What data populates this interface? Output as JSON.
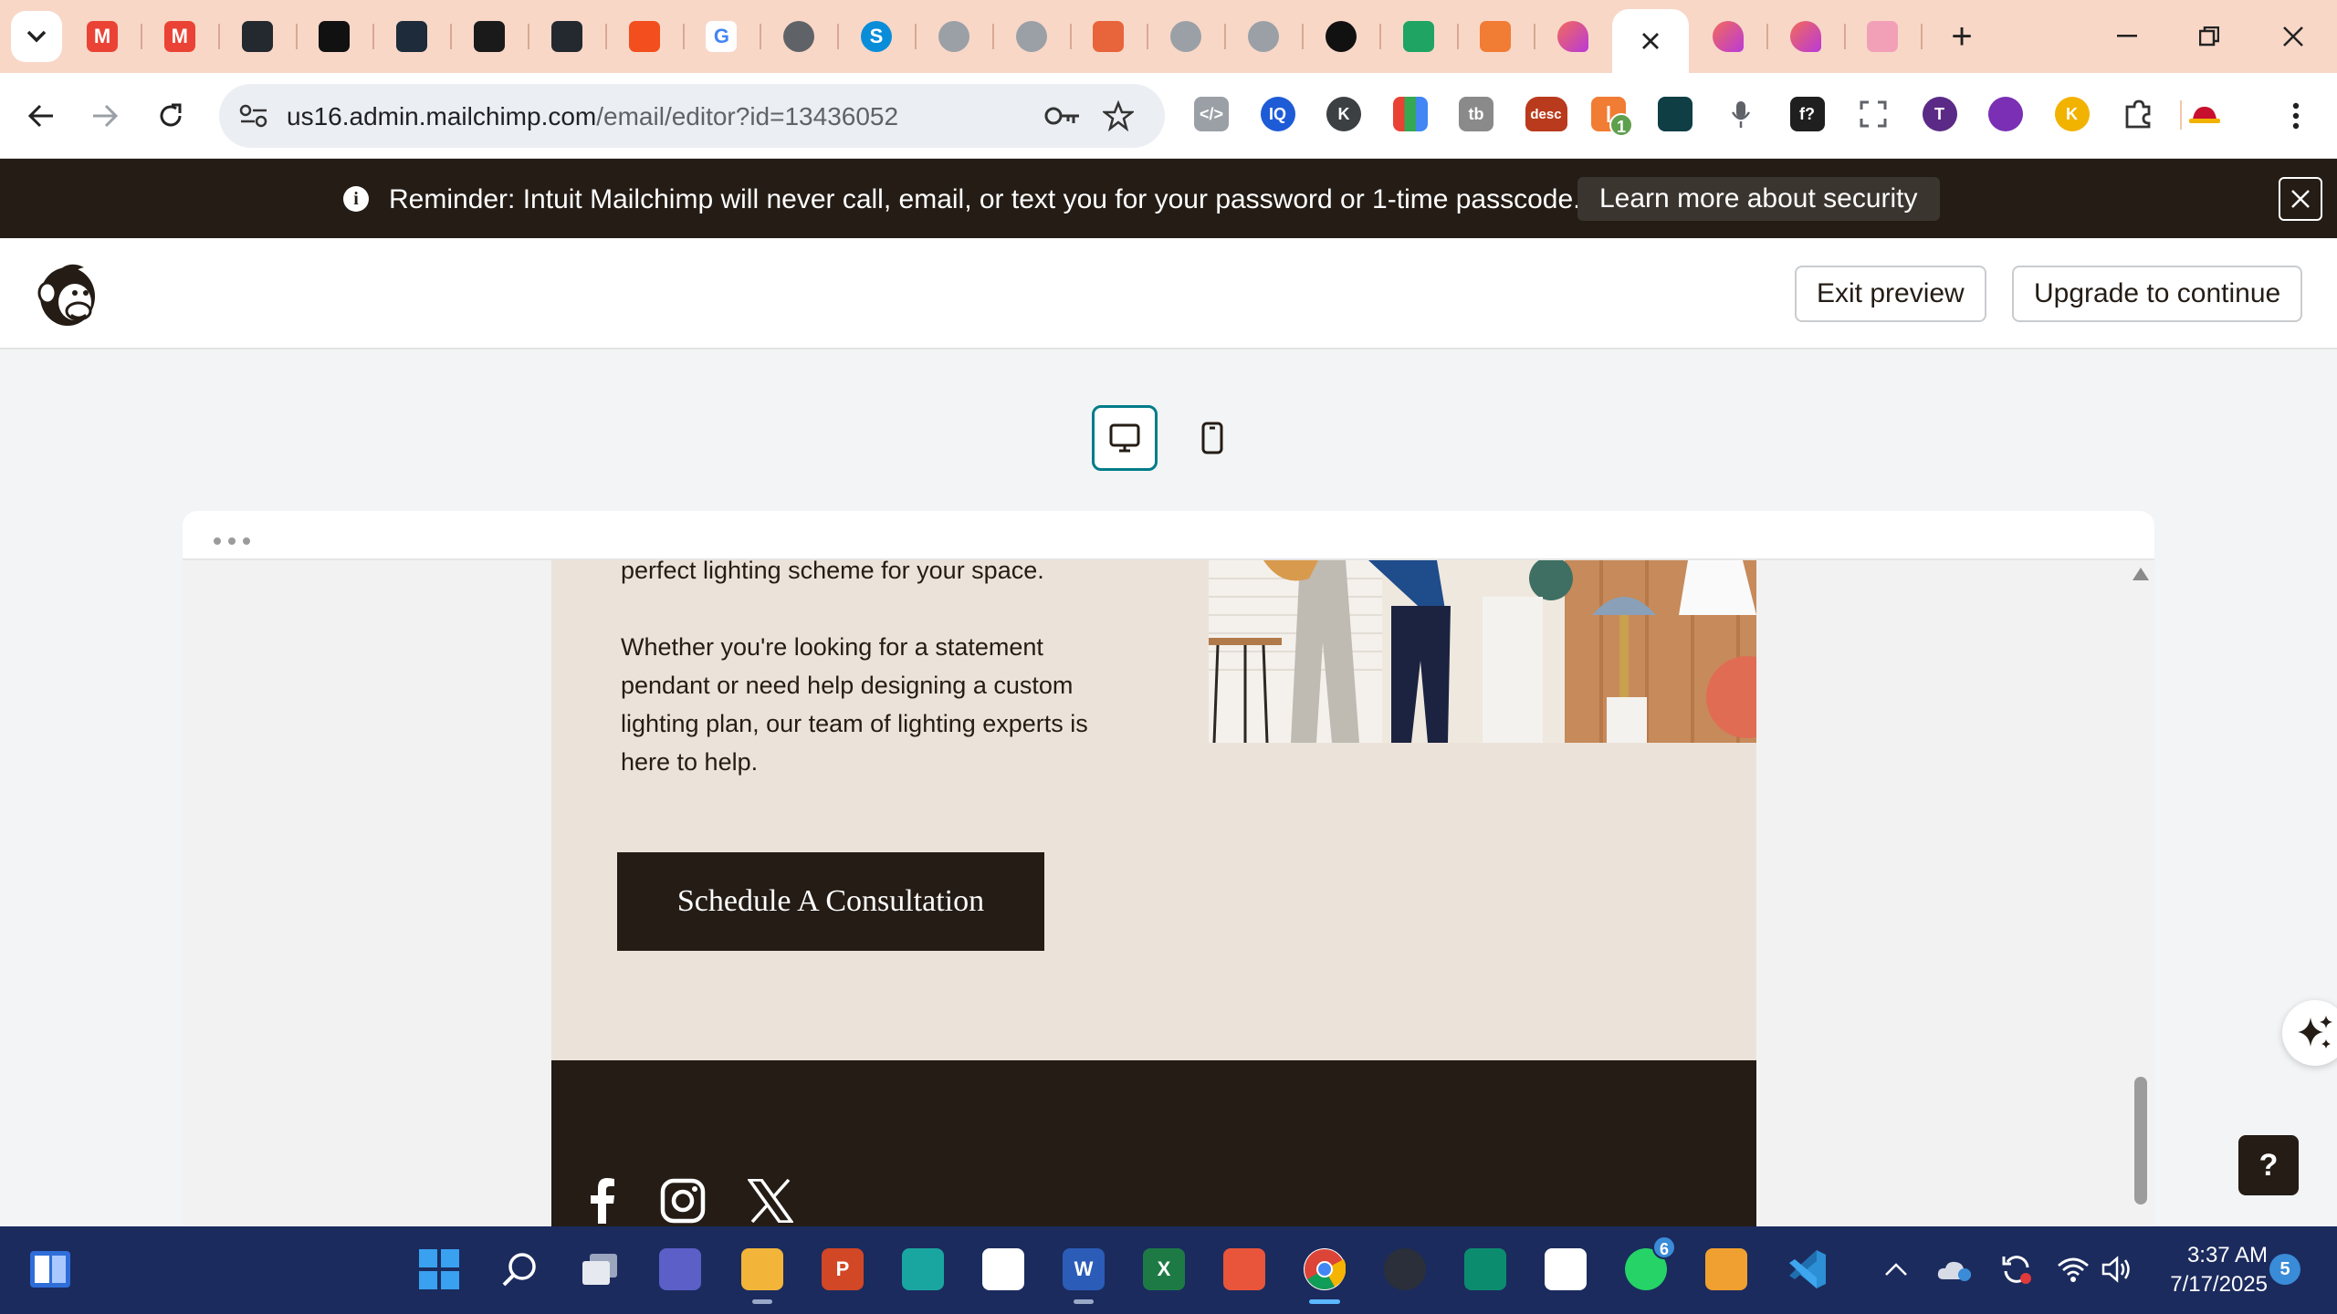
{
  "browser": {
    "tabs": [
      {
        "icon": "gmail-icon",
        "label": "M",
        "color": "#ea4335"
      },
      {
        "icon": "gmail-icon",
        "label": "M",
        "color": "#ea4335"
      },
      {
        "icon": "github-icon",
        "label": "",
        "color": "#24292f"
      },
      {
        "icon": "tool-icon",
        "label": "",
        "color": "#111111"
      },
      {
        "icon": "react-icon",
        "label": "",
        "color": "#1d2b3a"
      },
      {
        "icon": "bolt-icon",
        "label": "",
        "color": "#1a1a1a"
      },
      {
        "icon": "github-icon",
        "label": "",
        "color": "#24292f"
      },
      {
        "icon": "slides-icon",
        "label": "",
        "color": "#f24e1e"
      },
      {
        "icon": "google-icon",
        "label": "G",
        "color": "#ffffff"
      },
      {
        "icon": "globe-icon",
        "label": "",
        "color": "#5f6368"
      },
      {
        "icon": "skype-icon",
        "label": "S",
        "color": "#0a8dd9"
      },
      {
        "icon": "avatar-icon",
        "label": "",
        "color": "#9aa0a6"
      },
      {
        "icon": "avatar-icon",
        "label": "",
        "color": "#9aa0a6"
      },
      {
        "icon": "mail-icon",
        "label": "",
        "color": "#e8643a"
      },
      {
        "icon": "avatar-icon",
        "label": "",
        "color": "#9aa0a6"
      },
      {
        "icon": "avatar-icon",
        "label": "",
        "color": "#9aa0a6"
      },
      {
        "icon": "openai-icon",
        "label": "",
        "color": "#111111"
      },
      {
        "icon": "drive-icon",
        "label": "",
        "color": "#1fa463"
      },
      {
        "icon": "tool-icon",
        "label": "",
        "color": "#f17c34"
      },
      {
        "icon": "mailchimp-icon",
        "label": "",
        "color": "#d94c8a"
      },
      {
        "icon": "close-icon",
        "label": "",
        "color": "#ffffff",
        "active": true
      },
      {
        "icon": "mailchimp-icon",
        "label": "",
        "color": "#d94c8a"
      },
      {
        "icon": "mailchimp-icon",
        "label": "",
        "color": "#d94c8a"
      },
      {
        "icon": "brain-icon",
        "label": "",
        "color": "#f2a0b8"
      }
    ],
    "url_host": "us16.admin.mailchimp.com",
    "url_path": "/email/editor?id=13436052",
    "extension_badge": "1",
    "extensions": [
      {
        "icon": "code-icon",
        "label": "</>",
        "color": "#9aa0a6"
      },
      {
        "icon": "iq-icon",
        "label": "IQ",
        "color": "#1e5bd7"
      },
      {
        "icon": "k-icon",
        "label": "K",
        "color": "#3c4043"
      },
      {
        "icon": "palette-icon",
        "label": "",
        "color": "#e94235"
      },
      {
        "icon": "tb-icon",
        "label": "tb",
        "color": "#8a8a8a"
      },
      {
        "icon": "desc-icon",
        "label": "desc",
        "color": "#b93a1d"
      },
      {
        "icon": "counter-icon",
        "label": "",
        "color": "#f17c34"
      },
      {
        "icon": "diamond-icon",
        "label": "",
        "color": "#0f3e45"
      },
      {
        "icon": "mic-icon",
        "label": "",
        "color": "#5f6368"
      },
      {
        "icon": "function-icon",
        "label": "f?",
        "color": "#1f1f1f"
      },
      {
        "icon": "expand-icon",
        "label": "",
        "color": "#5f6368"
      },
      {
        "icon": "t-icon",
        "label": "T",
        "color": "#5b2a86"
      },
      {
        "icon": "eye-icon",
        "label": "",
        "color": "#7a2fb5"
      },
      {
        "icon": "k-icon",
        "label": "K",
        "color": "#f2b200"
      },
      {
        "icon": "puzzle-icon",
        "label": "",
        "color": "#3c4043"
      },
      {
        "icon": "hat-icon",
        "label": "",
        "color": "#c8102e"
      }
    ]
  },
  "banner": {
    "text": "Reminder: Intuit Mailchimp will never call, email, or text you for your password or 1-time passcode.",
    "link": "Learn more about security"
  },
  "header": {
    "exit_preview": "Exit preview",
    "upgrade": "Upgrade to continue"
  },
  "email": {
    "paragraph_1_tail": "perfect lighting scheme for your space.",
    "paragraph_2": "Whether you're looking for a statement pendant or need help designing a custom lighting plan, our team of lighting experts is here to help.",
    "cta": "Schedule A Consultation",
    "social": [
      "facebook-icon",
      "instagram-icon",
      "x-icon"
    ]
  },
  "help": {
    "label": "?"
  },
  "taskbar": {
    "apps": [
      {
        "icon": "windows-start-icon",
        "label": ""
      },
      {
        "icon": "search-icon",
        "label": ""
      },
      {
        "icon": "task-view-icon",
        "label": ""
      },
      {
        "icon": "teams-icon",
        "label": ""
      },
      {
        "icon": "file-explorer-icon",
        "label": ""
      },
      {
        "icon": "powerpoint-icon",
        "label": "P"
      },
      {
        "icon": "edge-icon",
        "label": ""
      },
      {
        "icon": "store-icon",
        "label": ""
      },
      {
        "icon": "word-icon",
        "label": "W"
      },
      {
        "icon": "excel-icon",
        "label": "X"
      },
      {
        "icon": "fruit-app-icon",
        "label": ""
      },
      {
        "icon": "chrome-icon",
        "label": ""
      },
      {
        "icon": "obs-icon",
        "label": ""
      },
      {
        "icon": "filmora-icon",
        "label": ""
      },
      {
        "icon": "capcut-icon",
        "label": ""
      },
      {
        "icon": "whatsapp-icon",
        "label": ""
      },
      {
        "icon": "vpn-icon",
        "label": ""
      },
      {
        "icon": "vscode-icon",
        "label": ""
      }
    ],
    "whatsapp_badge": "6",
    "time": "3:37 AM",
    "date": "7/17/2025",
    "notifications": "5"
  }
}
